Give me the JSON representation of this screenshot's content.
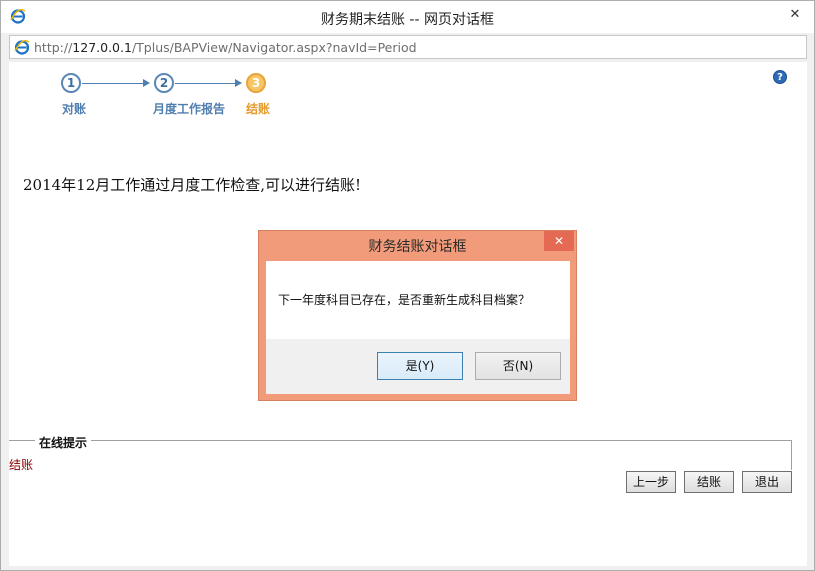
{
  "window": {
    "title": "财务期末结账 -- 网页对话框",
    "close_glyph": "✕",
    "browser_icon": "ie-icon"
  },
  "address": {
    "prefix": "http://",
    "host": "127.0.0.1",
    "path": "/Tplus/BAPView/Navigator.aspx?navId=Period"
  },
  "steps": [
    {
      "number": "1",
      "label": "对账",
      "active": false
    },
    {
      "number": "2",
      "label": "月度工作报告",
      "active": false
    },
    {
      "number": "3",
      "label": "结账",
      "active": true
    }
  ],
  "help_glyph": "?",
  "message": "2014年12月工作通过月度工作检查,可以进行结账!",
  "dialog": {
    "title": "财务结账对话框",
    "close_glyph": "✕",
    "message": "下一年度科目已存在，是否重新生成科目档案？",
    "yes_label": "是(Y)",
    "no_label": "否(N)"
  },
  "hints": {
    "legend": "在线提示",
    "text": "结账"
  },
  "actions": {
    "prev_label": "上一步",
    "close_label": "结账",
    "exit_label": "退出"
  },
  "colors": {
    "dialog_frame": "#f29b7a",
    "active_step": "#e59b2e",
    "step": "#4f7eb0"
  }
}
